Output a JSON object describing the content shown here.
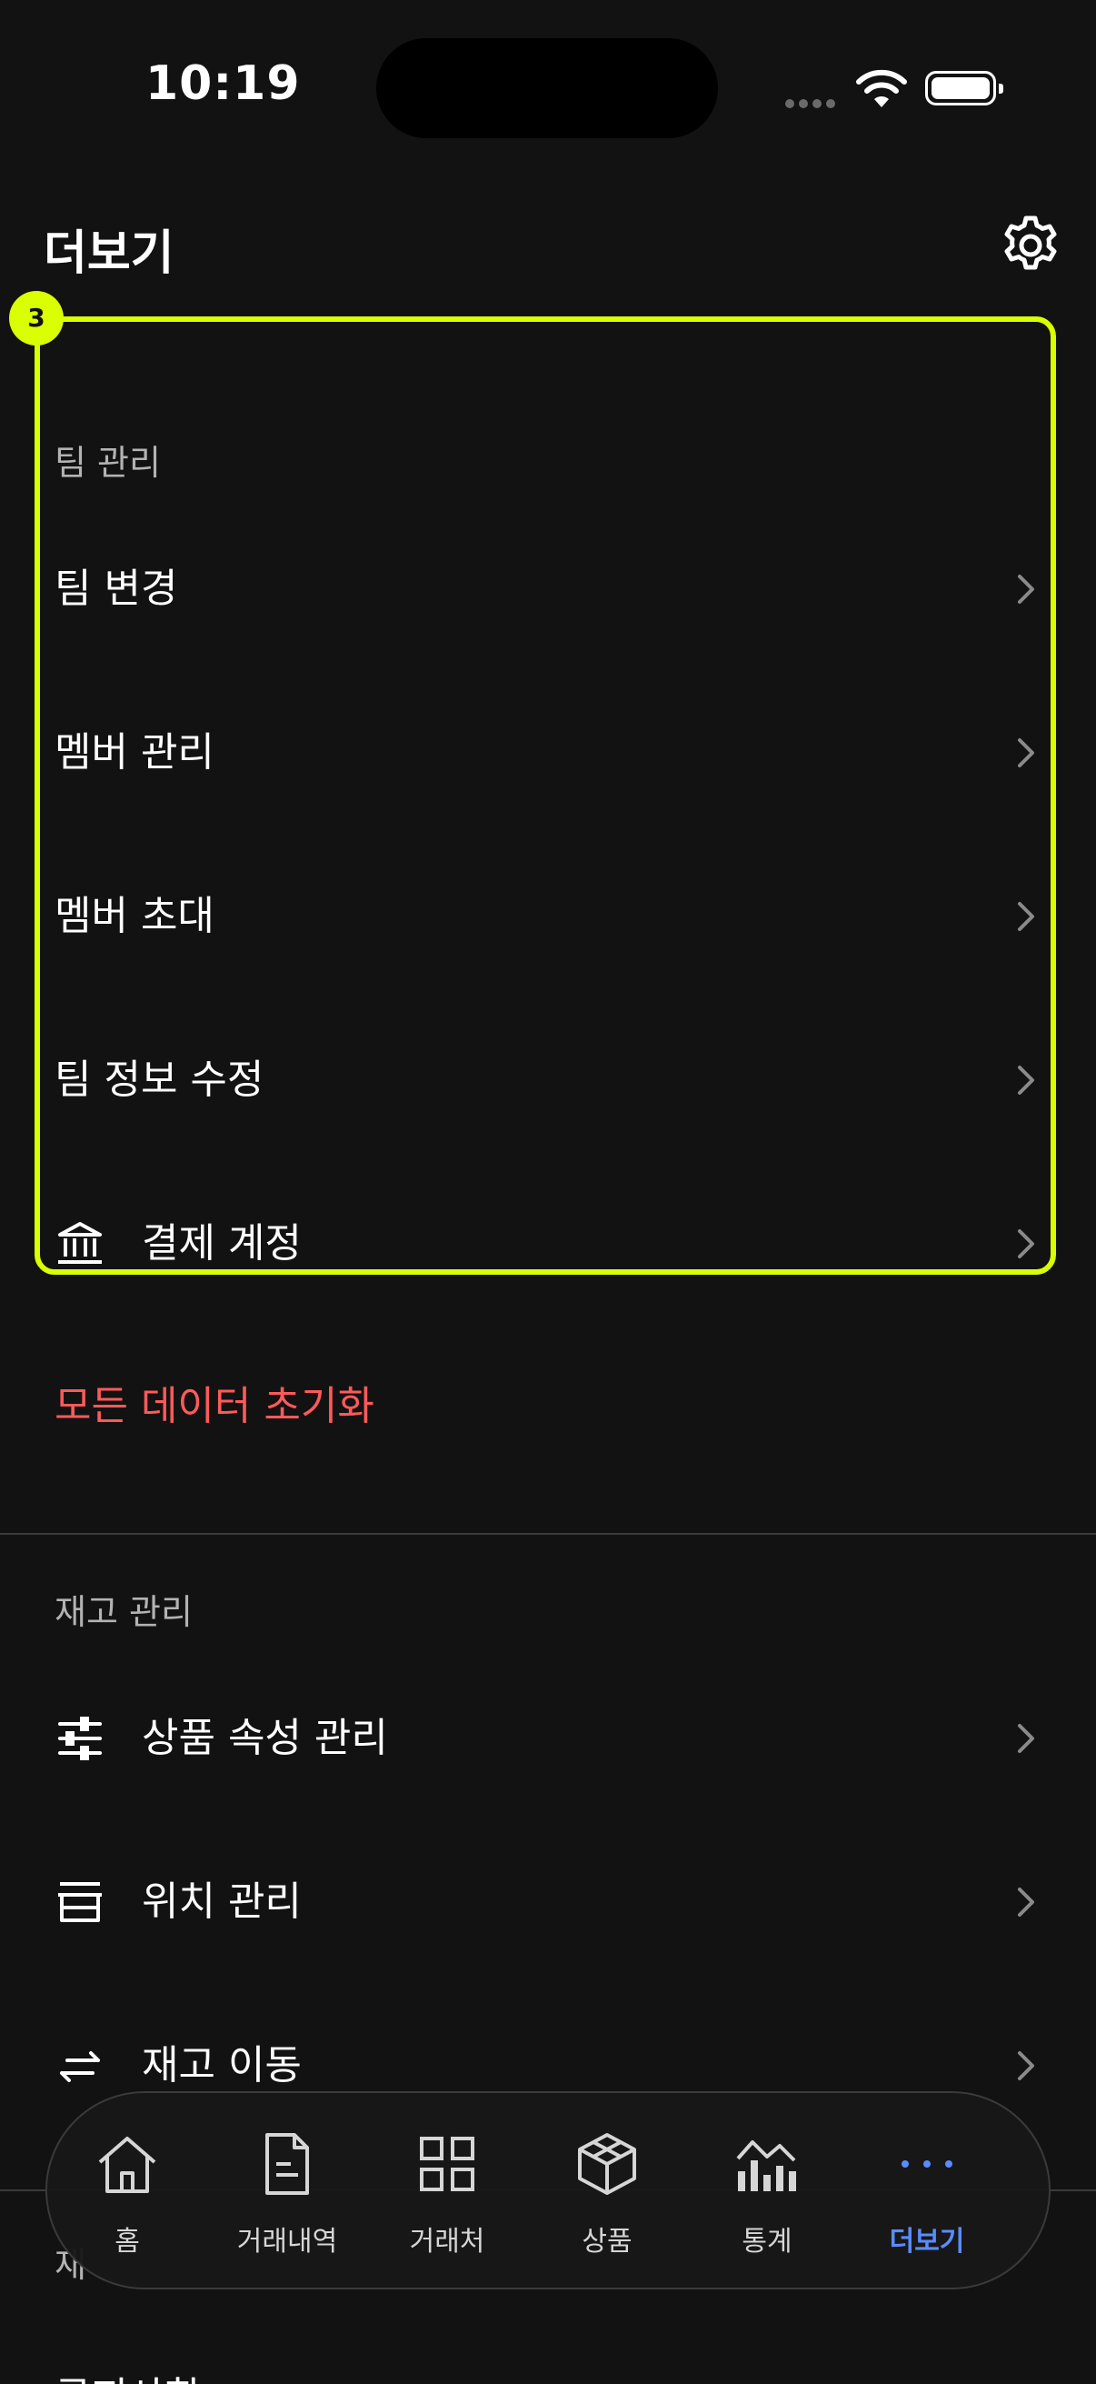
{
  "status_bar": {
    "time": "10:19"
  },
  "header": {
    "title": "더보기",
    "settings_icon": "gear-icon"
  },
  "highlight": {
    "badge": "3",
    "color": "#d9ff00"
  },
  "team_section": {
    "title": "팀 관리",
    "items": [
      {
        "label": "팀 변경"
      },
      {
        "label": "멤버 관리"
      },
      {
        "label": "멤버 초대"
      },
      {
        "label": "팀 정보 수정"
      },
      {
        "label": "결제 계정",
        "icon": "bank-icon"
      }
    ]
  },
  "danger": {
    "label": "모든 데이터 초기화",
    "color": "#ff5a5a"
  },
  "inventory_section": {
    "title": "재고 관리",
    "items": [
      {
        "label": "상품 속성 관리",
        "icon": "sliders-icon"
      },
      {
        "label": "위치 관리",
        "icon": "store-icon"
      },
      {
        "label": "재고 이동",
        "icon": "transfer-arrows-icon"
      }
    ]
  },
  "partial": {
    "section_fragment": "재",
    "row_fragment": "공지사항"
  },
  "tabbar": {
    "tabs": [
      {
        "label": "홈",
        "icon": "home-icon"
      },
      {
        "label": "거래내역",
        "icon": "document-icon"
      },
      {
        "label": "거래처",
        "icon": "grid-icon"
      },
      {
        "label": "상품",
        "icon": "box-icon"
      },
      {
        "label": "통계",
        "icon": "chart-icon"
      },
      {
        "label": "더보기",
        "icon": "more-dots-icon",
        "active": true
      }
    ],
    "active_color": "#5a8cff"
  }
}
